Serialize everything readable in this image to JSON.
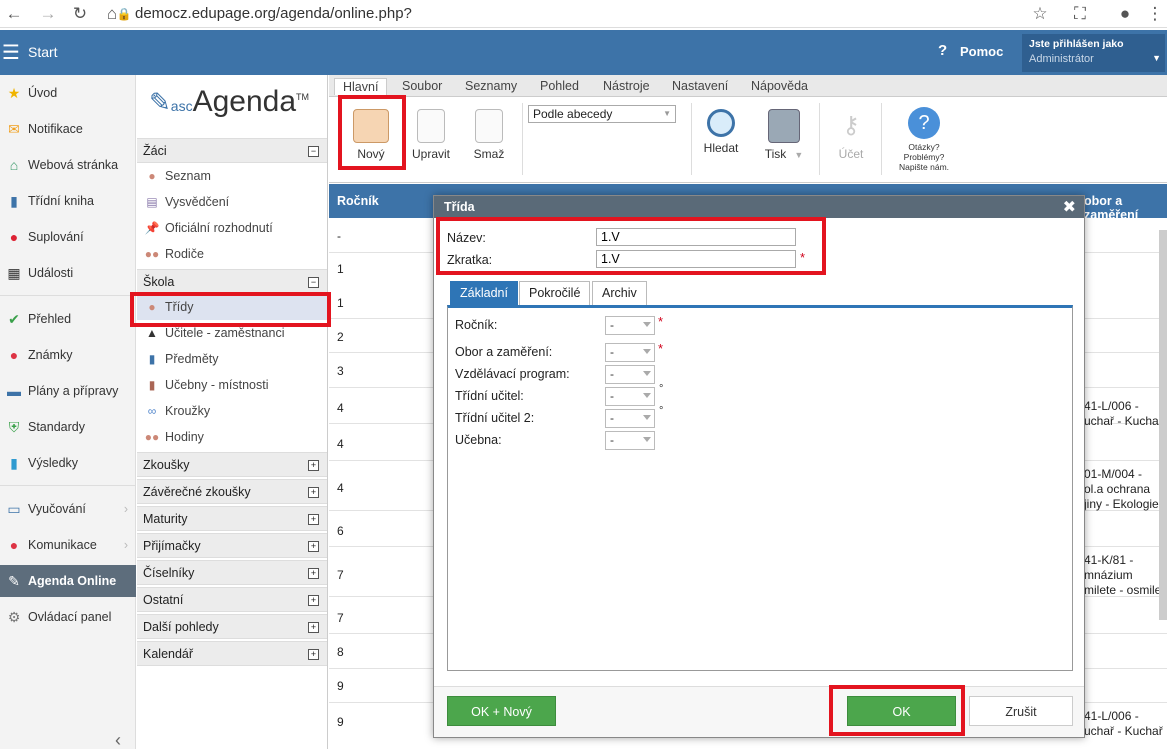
{
  "browser": {
    "url": "democz.edupage.org/agenda/online.php?"
  },
  "topbar": {
    "start_label": "Start",
    "help_label": "Pomoc",
    "logged_in_label": "Jste přihlášen jako",
    "user_role": "Administrátor"
  },
  "leftnav": {
    "items": [
      {
        "label": "Úvod",
        "icon": "star-icon"
      },
      {
        "label": "Notifikace",
        "icon": "envelope-icon"
      },
      {
        "label": "Webová stránka",
        "icon": "home-icon"
      },
      {
        "label": "Třídní kniha",
        "icon": "book-icon"
      },
      {
        "label": "Suplování",
        "icon": "person-icon"
      },
      {
        "label": "Události",
        "icon": "calendar-icon"
      },
      {
        "label": "Přehled",
        "icon": "check-icon"
      },
      {
        "label": "Známky",
        "icon": "grade-icon"
      },
      {
        "label": "Plány a přípravy",
        "icon": "briefcase-icon"
      },
      {
        "label": "Standardy",
        "icon": "shield-icon"
      },
      {
        "label": "Výsledky",
        "icon": "bar-chart-icon"
      },
      {
        "label": "Vyučování",
        "icon": "book-open-icon"
      },
      {
        "label": "Komunikace",
        "icon": "chat-icon"
      },
      {
        "label": "Agenda Online",
        "icon": "pen-icon"
      },
      {
        "label": "Ovládací panel",
        "icon": "gear-icon"
      }
    ]
  },
  "sidebar": {
    "logo_prefix": "asc",
    "logo_text": "Agenda",
    "logo_tm": "TM",
    "sections": {
      "zaci": "Žáci",
      "skola": "Škola",
      "zkousky": "Zkoušky",
      "zaverecne": "Závěrečné zkoušky",
      "maturity": "Maturity",
      "prijimacky": "Přijímačky",
      "ciselniky": "Číselníky",
      "ostatni": "Ostatní",
      "dalsi": "Další pohledy",
      "kalendar": "Kalendář"
    },
    "zaci_items": [
      "Seznam",
      "Vysvědčení",
      "Oficiální rozhodnutí",
      "Rodiče"
    ],
    "skola_items": [
      "Třídy",
      "Učitele - zaměstnanci",
      "Předměty",
      "Učebny - místnosti",
      "Kroužky",
      "Hodiny"
    ]
  },
  "ribbon": {
    "tabs": [
      "Hlavní",
      "Soubor",
      "Seznamy",
      "Pohled",
      "Nástroje",
      "Nastavení",
      "Nápověda"
    ],
    "buttons": {
      "new": "Nový",
      "edit": "Upravit",
      "delete": "Smaž",
      "search": "Hledat",
      "print": "Tisk",
      "account": "Účet"
    },
    "sort_value": "Podle abecedy",
    "help_lines": [
      "Otázky?",
      "Problémy?",
      "Napište nám."
    ]
  },
  "grid": {
    "header_left": "Ročník",
    "header_right": "obor a zaměření",
    "rows": [
      "-",
      "1",
      "1",
      "2",
      "3",
      "4",
      "4",
      "4",
      "6",
      "7",
      "7",
      "8",
      "9",
      "9"
    ],
    "right_cells": [
      [
        "41-L/006 -",
        "uchař - Kuchař"
      ],
      [
        "01-M/004 -",
        "ol.a ochrana",
        "jiny - Ekologie"
      ],
      [
        "41-K/81 -",
        "mnázium",
        "milete - osmilet"
      ],
      [
        "41-L/006 -",
        "uchař - Kuchař"
      ]
    ]
  },
  "dialog": {
    "title": "Třída",
    "name_label": "Název:",
    "name_value": "1.V",
    "short_label": "Zkratka:",
    "short_value": "1.V",
    "tabs": [
      "Základní",
      "Pokročilé",
      "Archiv"
    ],
    "fields": [
      {
        "label": "Ročník:",
        "value": "-",
        "marker": "*"
      },
      {
        "label": "Obor a zaměření:",
        "value": "-",
        "marker": "*"
      },
      {
        "label": "Vzdělávací program:",
        "value": "-",
        "marker": ""
      },
      {
        "label": "Třídní učitel:",
        "value": "-",
        "marker": "°"
      },
      {
        "label": "Třídní učitel 2:",
        "value": "-",
        "marker": "°"
      },
      {
        "label": "Učebna:",
        "value": "-",
        "marker": ""
      }
    ],
    "ok_new_label": "OK + Nový",
    "ok_label": "OK",
    "cancel_label": "Zrušit"
  },
  "colors": {
    "brand_blue": "#3d73a8",
    "highlight_red": "#e3141f",
    "ok_green": "#4ca64c",
    "dialog_header": "#5a6a78"
  }
}
